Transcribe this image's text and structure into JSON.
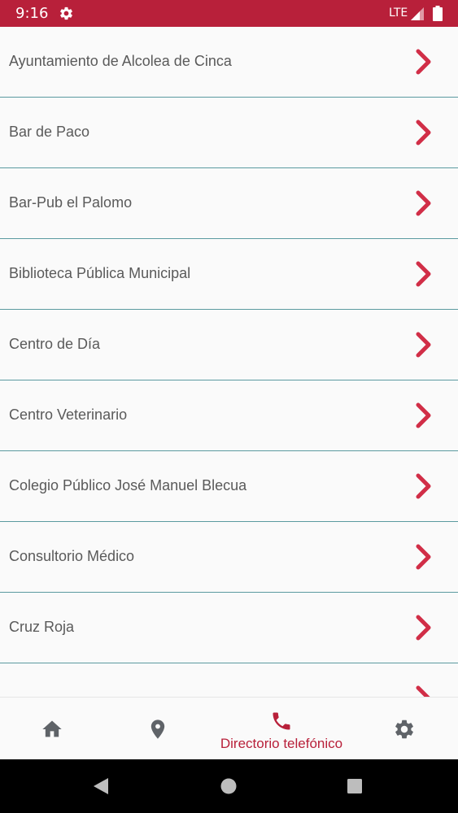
{
  "status_bar": {
    "time": "9:16",
    "network": "LTE",
    "color": "#b8203a",
    "icons": [
      "gear-icon",
      "signal-icon",
      "battery-icon"
    ]
  },
  "directory": {
    "items": [
      {
        "label": "Ayuntamiento de Alcolea de Cinca"
      },
      {
        "label": "Bar de Paco"
      },
      {
        "label": "Bar-Pub el Palomo"
      },
      {
        "label": "Biblioteca Pública Municipal"
      },
      {
        "label": "Centro de Día"
      },
      {
        "label": "Centro Veterinario"
      },
      {
        "label": "Colegio Público José Manuel Blecua"
      },
      {
        "label": "Consultorio Médico"
      },
      {
        "label": "Cruz Roja"
      }
    ],
    "accent_color": "#d12e47",
    "divider_color": "#5b9aa0"
  },
  "bottom_nav": {
    "items": [
      {
        "icon": "home-icon"
      },
      {
        "icon": "location-pin-icon"
      },
      {
        "icon": "phone-icon",
        "label": "Directorio telefónico",
        "active": true
      },
      {
        "icon": "gear-icon"
      }
    ]
  },
  "system_nav": {
    "icons": [
      "back-icon",
      "home-circle-icon",
      "recents-icon"
    ]
  }
}
